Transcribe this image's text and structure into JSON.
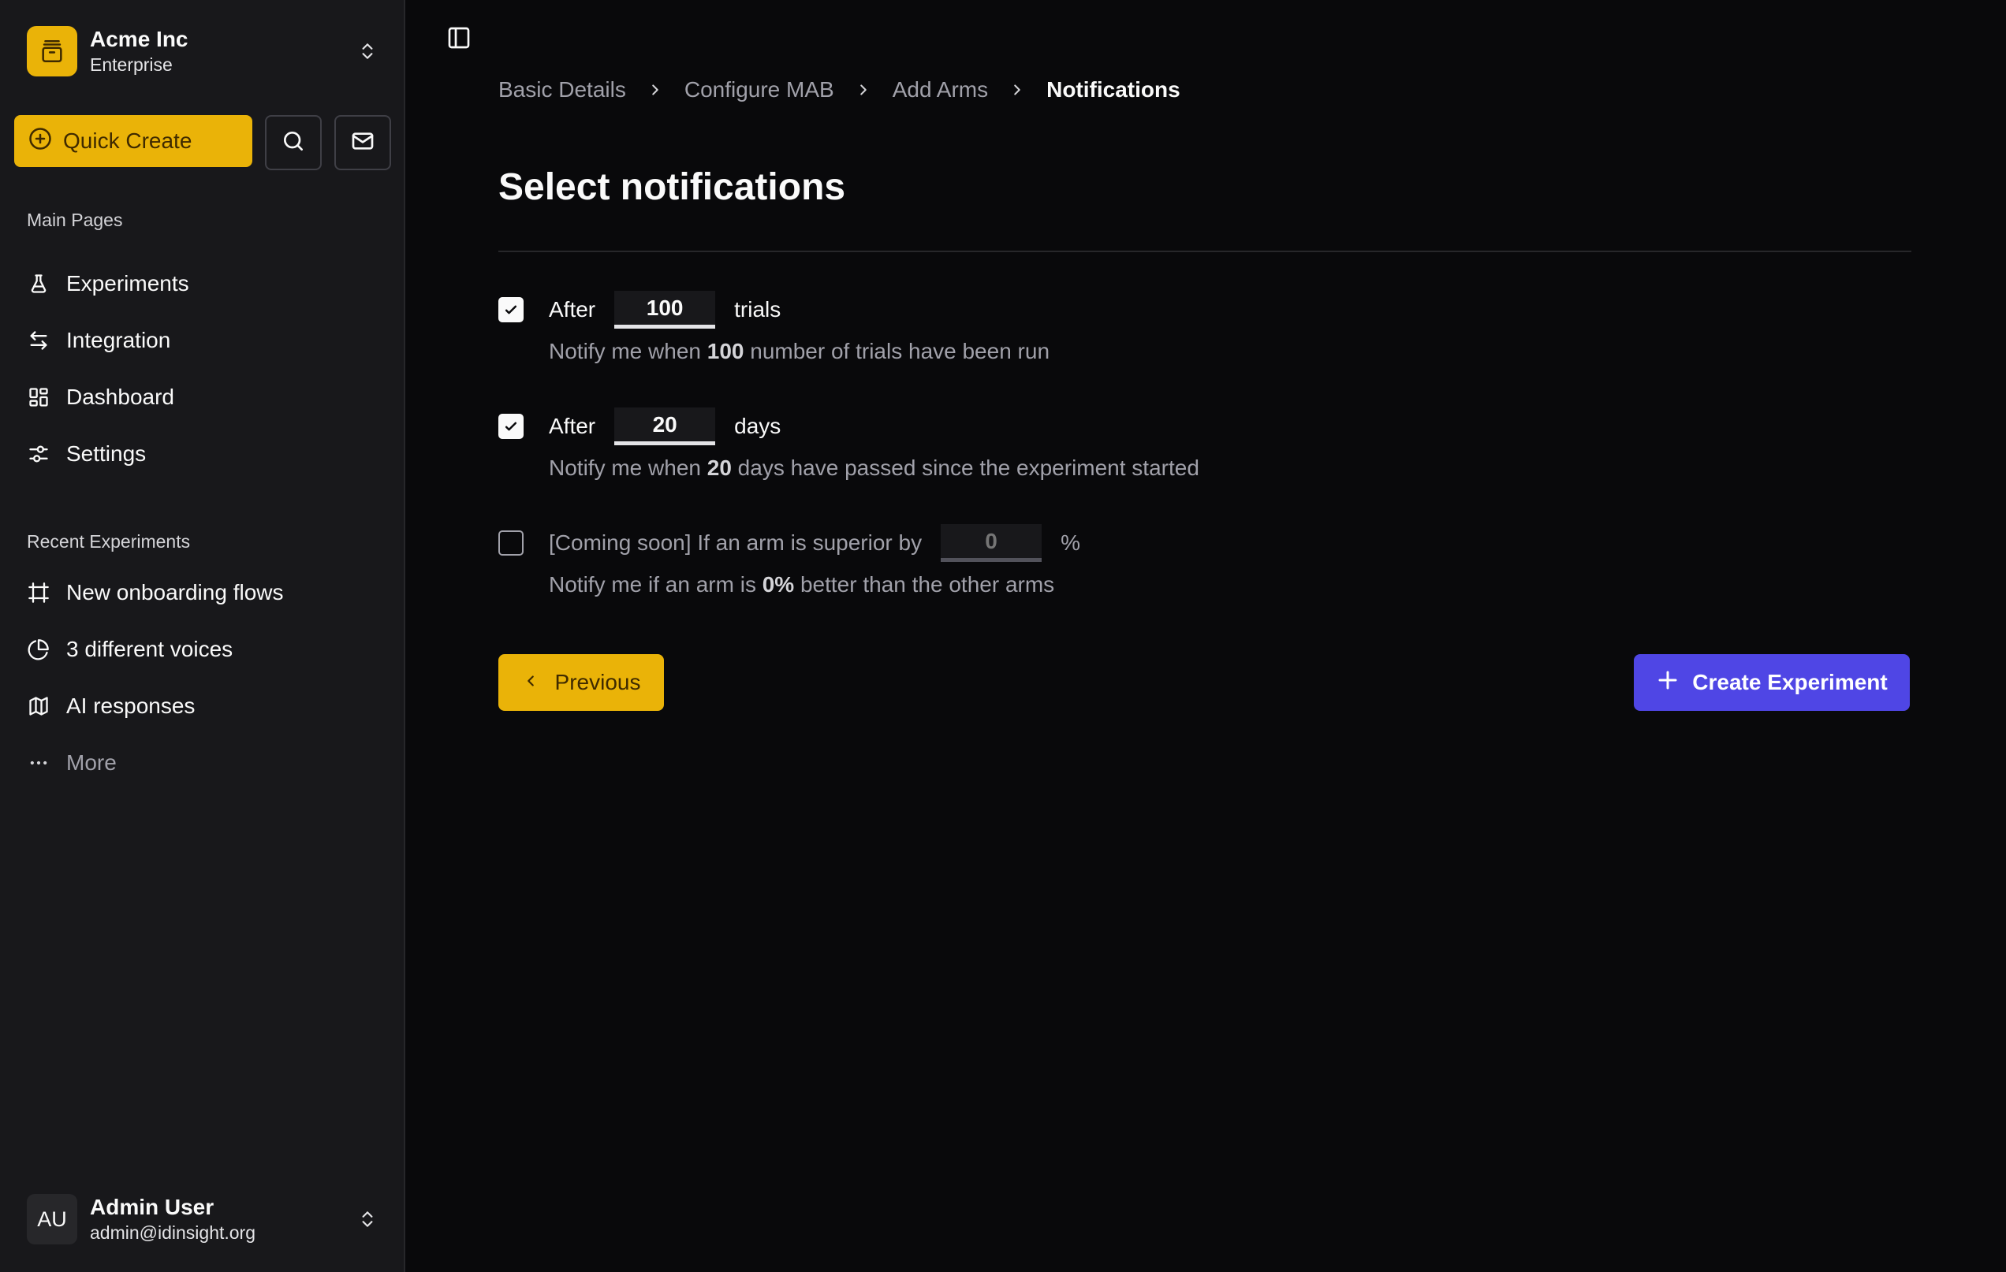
{
  "org": {
    "name": "Acme Inc",
    "plan": "Enterprise",
    "logo_icon": "box-icon",
    "accent": "#eab308"
  },
  "quick_create": {
    "label": "Quick Create",
    "icon": "plus-circle-icon"
  },
  "toolbar": {
    "search_icon": "search-icon",
    "mail_icon": "mail-icon"
  },
  "sidebar": {
    "main_label": "Main Pages",
    "main_items": [
      {
        "label": "Experiments",
        "icon": "flask-icon"
      },
      {
        "label": "Integration",
        "icon": "arrows-left-right-icon"
      },
      {
        "label": "Dashboard",
        "icon": "dashboard-grid-icon"
      },
      {
        "label": "Settings",
        "icon": "sliders-icon"
      }
    ],
    "recent_label": "Recent Experiments",
    "recent_items": [
      {
        "label": "New onboarding flows",
        "icon": "frame-icon"
      },
      {
        "label": "3 different voices",
        "icon": "pie-chart-icon"
      },
      {
        "label": "AI responses",
        "icon": "map-icon"
      },
      {
        "label": "More",
        "icon": "more-horizontal-icon"
      }
    ]
  },
  "user": {
    "initials": "AU",
    "name": "Admin User",
    "email": "admin@idinsight.org"
  },
  "breadcrumb": {
    "items": [
      "Basic Details",
      "Configure MAB",
      "Add Arms"
    ],
    "current": "Notifications"
  },
  "page": {
    "title": "Select notifications"
  },
  "options": {
    "trials": {
      "checked": true,
      "prefix": "After",
      "value": "100",
      "unit": "trials",
      "desc_before": "Notify me when ",
      "desc_value": "100",
      "desc_after": " number of trials have been run"
    },
    "days": {
      "checked": true,
      "prefix": "After",
      "value": "20",
      "unit": "days",
      "desc_before": "Notify me when ",
      "desc_value": "20",
      "desc_after": " days have passed since the experiment started"
    },
    "superior": {
      "checked": false,
      "prefix": "[Coming soon] If an arm is superior by",
      "placeholder": "0",
      "unit": "%",
      "desc_before": "Notify me if an arm is ",
      "desc_value": "0%",
      "desc_after": " better than the other arms"
    }
  },
  "actions": {
    "previous_label": "Previous",
    "create_label": "Create Experiment",
    "create_color": "#4f46e5"
  }
}
